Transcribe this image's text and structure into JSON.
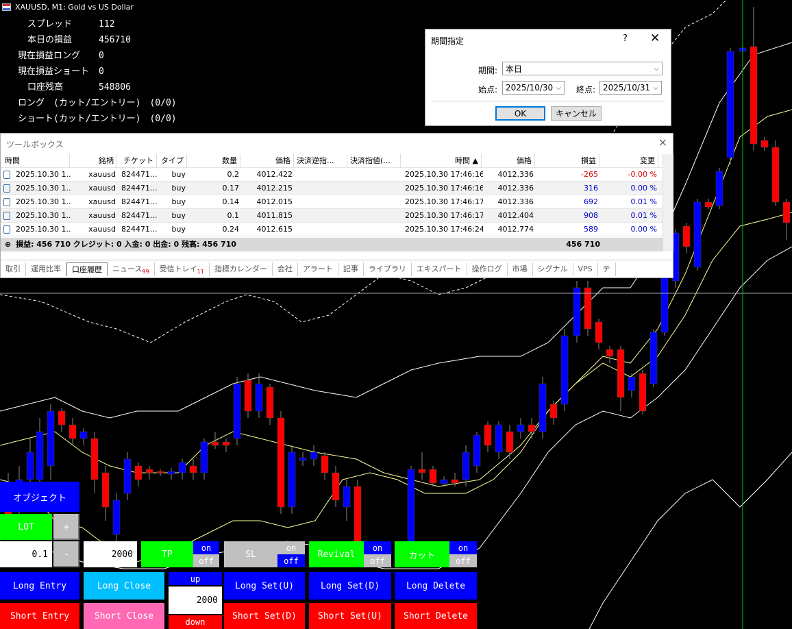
{
  "window": {
    "title": "XAUUSD, M1:  Gold vs US Dollar"
  },
  "info": {
    "spread_label": "スプレッド",
    "spread_value": "112",
    "today_pl_label": "本日の損益",
    "today_pl_value": "456710",
    "cur_long_label": "現在損益ロング",
    "cur_long_value": "0",
    "cur_short_label": "現在損益ショート",
    "cur_short_value": "0",
    "balance_label": "口座残高",
    "balance_value": "548806",
    "long_line": "ロング　(カット/エントリー)　(0/0)",
    "short_line": "ショート(カット/エントリー)　(0/0)"
  },
  "dialog": {
    "title": "期間指定",
    "help": "?",
    "close": "✕",
    "period_label": "期間:",
    "period_value": "本日",
    "start_label": "始点:",
    "start_value": "2025/10/30",
    "end_label": "終点:",
    "end_value": "2025/10/31",
    "ok": "OK",
    "cancel": "キャンセル"
  },
  "toolbox": {
    "title": "ツールボックス",
    "columns": [
      "時間",
      "銘柄",
      "チケット",
      "タイプ",
      "数量",
      "価格",
      "決済逆指...",
      "決済指値(...",
      "時間 ▲",
      "価格",
      "損益",
      "変更"
    ],
    "rows": [
      [
        "2025.10.30 1...",
        "xauusd",
        "824471...",
        "buy",
        "0.2",
        "4012.422",
        "",
        "",
        "2025.10.30 17:46:16",
        "4012.336",
        "-265",
        "-0.00 %"
      ],
      [
        "2025.10.30 1...",
        "xauusd",
        "824471...",
        "buy",
        "0.17",
        "4012.215",
        "",
        "",
        "2025.10.30 17:46:16",
        "4012.336",
        "316",
        "0.00 %"
      ],
      [
        "2025.10.30 1...",
        "xauusd",
        "824471...",
        "buy",
        "0.14",
        "4012.015",
        "",
        "",
        "2025.10.30 17:46:17",
        "4012.336",
        "692",
        "0.01 %"
      ],
      [
        "2025.10.30 1...",
        "xauusd",
        "824471...",
        "buy",
        "0.1",
        "4011.815",
        "",
        "",
        "2025.10.30 17:46:17",
        "4012.404",
        "908",
        "0.01 %"
      ],
      [
        "2025.10.30 1...",
        "xauusd",
        "824471...",
        "buy",
        "0.24",
        "4012.615",
        "",
        "",
        "2025.10.30 17:46:24",
        "4012.774",
        "589",
        "0.00 %"
      ]
    ],
    "summary": "損益: 456 710  クレジット: 0  入金: 0  出金: 0  残高: 456 710",
    "summary_total": "456 710",
    "tabs": [
      {
        "label": "取引",
        "badge": ""
      },
      {
        "label": "運用比率",
        "badge": ""
      },
      {
        "label": "口座履歴",
        "badge": ""
      },
      {
        "label": "ニュース",
        "badge": "99"
      },
      {
        "label": "受信トレイ",
        "badge": "11"
      },
      {
        "label": "指標カレンダー",
        "badge": ""
      },
      {
        "label": "会社",
        "badge": ""
      },
      {
        "label": "アラート",
        "badge": ""
      },
      {
        "label": "記事",
        "badge": ""
      },
      {
        "label": "ライブラリ",
        "badge": ""
      },
      {
        "label": "エキスパート",
        "badge": ""
      },
      {
        "label": "操作ログ",
        "badge": ""
      },
      {
        "label": "市場",
        "badge": ""
      },
      {
        "label": "シグナル",
        "badge": ""
      },
      {
        "label": "VPS",
        "badge": ""
      },
      {
        "label": "テ",
        "badge": ""
      }
    ],
    "active_tab": "口座履歴"
  },
  "panel": {
    "object": "オブジェクト",
    "lot_label": "LOT",
    "plus": "+",
    "minus": "-",
    "lot_value": "0.1",
    "tp_value": "2000",
    "tp": "TP",
    "sl": "SL",
    "revival": "Revival",
    "cut": "カット",
    "on": "on",
    "off": "off",
    "long_entry": "Long Entry",
    "long_close": "Long Close",
    "short_entry": "Short Entry",
    "short_close": "Short Close",
    "up": "up",
    "down": "down",
    "step_value": "2000",
    "long_set_u": "Long Set(U)",
    "long_set_d": "Long Set(D)",
    "long_delete": "Long Delete",
    "short_set_d": "Short Set(D)",
    "short_set_u": "Short Set(U)",
    "short_delete": "Short Delete"
  },
  "colors": {
    "bull": "#0000ff",
    "bear": "#ff0000",
    "band": "#ffffff",
    "ma": "#ffff99",
    "crosshair": "#00c800"
  }
}
